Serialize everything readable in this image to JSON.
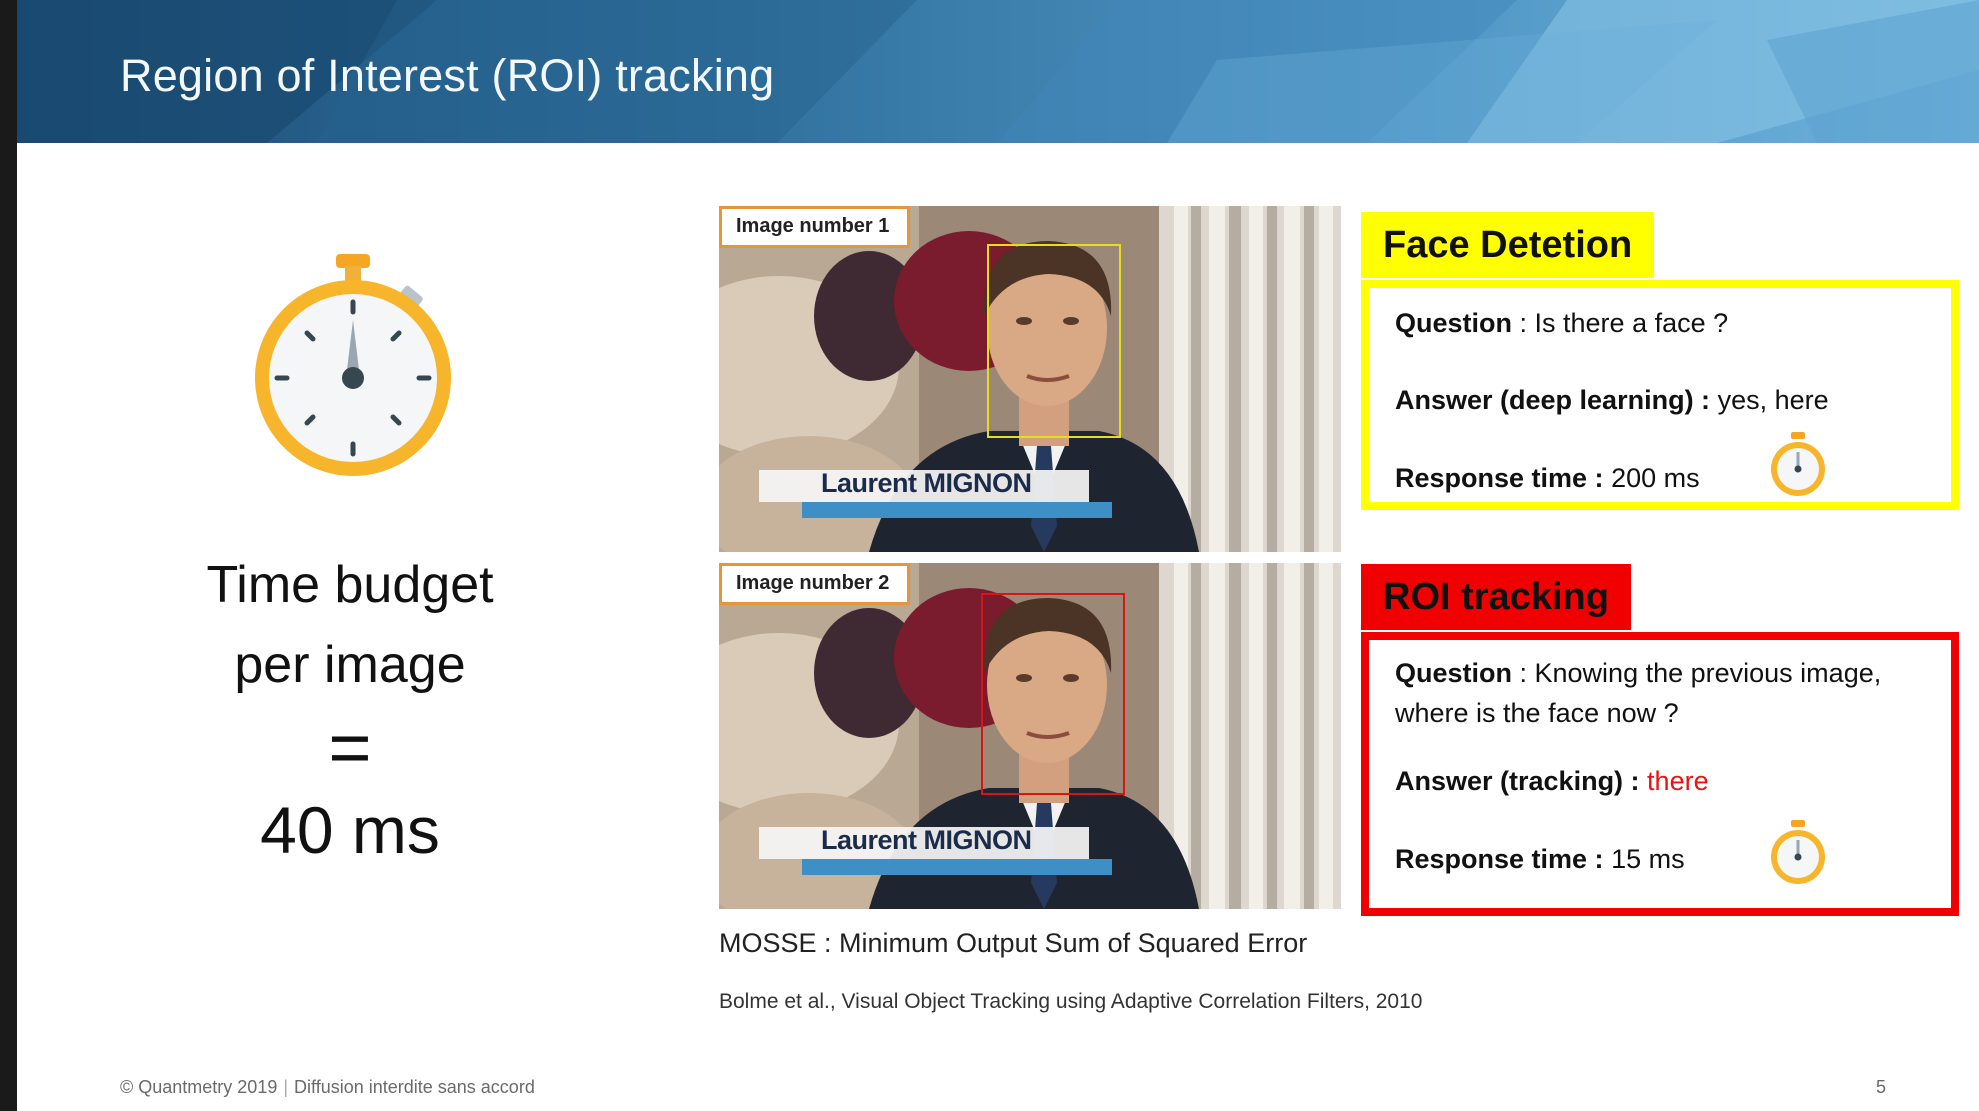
{
  "slide": {
    "title": "Region of Interest (ROI) tracking",
    "budget": {
      "line1": "Time budget",
      "line2": "per image",
      "equals": "=",
      "value": "40 ms"
    },
    "images": [
      {
        "label": "Image number 1",
        "box_color": "#e6dd1c"
      },
      {
        "label": "Image number 2",
        "box_color": "#d81515"
      }
    ],
    "name_caption": "Laurent MIGNON",
    "face_detection": {
      "title": "Face Detetion",
      "question_label": "Question",
      "question_text": " : Is there a face ?",
      "answer_label": "Answer (deep learning) :",
      "answer_text": " yes, here",
      "time_label": "Response time :",
      "time_value": " 200 ms",
      "color": "#ffff00"
    },
    "roi_tracking": {
      "title": "ROI tracking",
      "question_label": "Question",
      "question_text_1": " : Knowing the previous image,",
      "question_text_2": "where is the face now ?",
      "answer_label": "Answer (tracking) :",
      "answer_text": " there",
      "time_label": "Response time :",
      "time_value": " 15 ms",
      "color": "#f00000"
    },
    "mosse": "MOSSE : Minimum Output Sum of Squared Error",
    "reference": "Bolme et al., Visual Object Tracking using Adaptive Correlation Filters, 2010",
    "footer": {
      "copyright": "© Quantmetry 2019",
      "notice": "Diffusion interdite sans accord"
    },
    "page_number": "5"
  }
}
